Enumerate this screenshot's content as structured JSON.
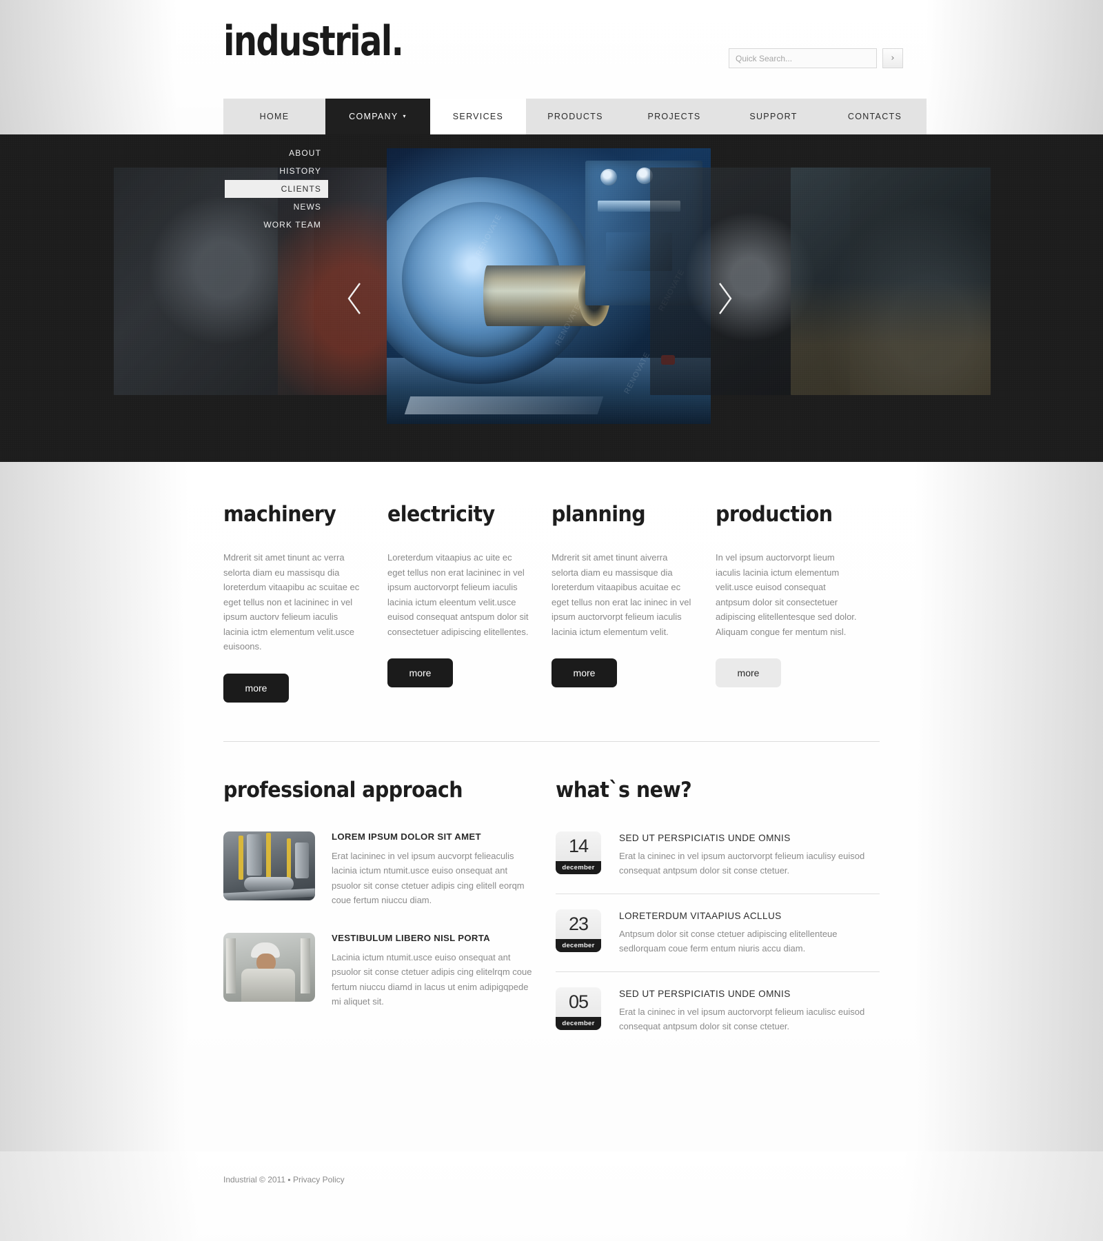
{
  "site": {
    "logo": "industrial.",
    "copyright": "Industrial © 2011 ▪ ",
    "privacy": "Privacy Policy"
  },
  "search": {
    "placeholder": "Quick Search...",
    "value": "",
    "button_icon": "›"
  },
  "nav": {
    "items": [
      {
        "label": "HOME",
        "state": "default"
      },
      {
        "label": "COMPANY",
        "state": "active",
        "caret": "▾"
      },
      {
        "label": "SERVICES",
        "state": "white"
      },
      {
        "label": "PRODUCTS",
        "state": "default"
      },
      {
        "label": "PROJECTS",
        "state": "default"
      },
      {
        "label": "SUPPORT",
        "state": "default"
      },
      {
        "label": "CONTACTS",
        "state": "default"
      }
    ],
    "dropdown": [
      {
        "label": "ABOUT",
        "selected": false
      },
      {
        "label": "HISTORY",
        "selected": false
      },
      {
        "label": "CLIENTS",
        "selected": true
      },
      {
        "label": "NEWS",
        "selected": false
      },
      {
        "label": "WORK TEAM",
        "selected": false
      }
    ]
  },
  "slider": {
    "prev_label": "previous-slide",
    "next_label": "next-slide",
    "watermarks": [
      "RENOVATE",
      "RENOVATE",
      "RENOVATE",
      "RENOVATE"
    ]
  },
  "services": [
    {
      "title": "machinery",
      "text": "Mdrerit sit amet tinunt ac verra selorta diam eu massisqu dia loreterdum vitaapibu ac scuitae ec eget tellus non et lacininec in vel ipsum auctorv felieum iaculis lacinia ictm elementum velit.usce euisoons.",
      "more": "more",
      "state": "dark"
    },
    {
      "title": "electricity",
      "text": "Loreterdum vitaapius ac uite ec eget tellus non erat lacininec in vel ipsum auctorvorpt felieum iaculis lacinia ictum eleentum velit.usce euisod consequat antspum dolor sit consectetuer adipiscing elitellentes.",
      "more": "more",
      "state": "dark"
    },
    {
      "title": "planning",
      "text": "Mdrerit sit amet tinunt aiverra selorta diam eu massisque dia loreterdum vitaapibus acuitae ec eget tellus non erat lac ininec in vel ipsum auctorvorpt felieum iaculis lacinia ictum elementum velit.",
      "more": "more",
      "state": "dark"
    },
    {
      "title": "production",
      "text": "In vel ipsum auctorvorpt lieum iaculis lacinia ictum elementum velit.usce euisod consequat antpsum dolor sit consectetuer adipiscing elitellentesque sed dolor. Aliquam congue fer mentum nisl.",
      "more": "more",
      "state": "hover"
    }
  ],
  "approach": {
    "heading": "professional approach",
    "posts": [
      {
        "title": "LOREM IPSUM DOLOR SIT AMET",
        "text": "Erat lacininec in vel ipsum aucvorpt felieaculis lacinia ictum ntumit.usce euiso onsequat ant psuolor sit conse ctetuer adipis cing elitell eorqm coue fertum niuccu diam.",
        "thumb": "pipes-photo"
      },
      {
        "title": "VESTIBULUM LIBERO NISL PORTA",
        "text": "Lacinia ictum ntumit.usce euiso onsequat ant psuolor sit conse ctetuer adipis cing elitelrqm coue fertum niuccu diamd in lacus ut enim adipigqpede mi aliquet sit.",
        "thumb": "worker-photo"
      }
    ]
  },
  "news": {
    "heading": "what`s new?",
    "items": [
      {
        "day": "14",
        "month": "december",
        "title": "SED UT PERSPICIATIS UNDE OMNIS",
        "text": "Erat la cininec in vel ipsum auctorvorpt felieum iaculisy euisod consequat antpsum dolor sit conse ctetuer."
      },
      {
        "day": "23",
        "month": "december",
        "title": "LORETERDUM VITAAPIUS ACLLUS",
        "text": "Antpsum dolor sit conse ctetuer adipiscing elitellenteue sedlorquam coue ferm entum niuris accu diam."
      },
      {
        "day": "05",
        "month": "december",
        "title": "SED UT PERSPICIATIS UNDE OMNIS",
        "text": "Erat la cininec in vel ipsum auctorvorpt felieum iaculisc euisod consequat antpsum dolor sit conse ctetuer."
      }
    ]
  },
  "colors": {
    "dark": "#1b1b1b",
    "nav_bg": "#e3e3e3",
    "text_muted": "#8b8b8b"
  }
}
